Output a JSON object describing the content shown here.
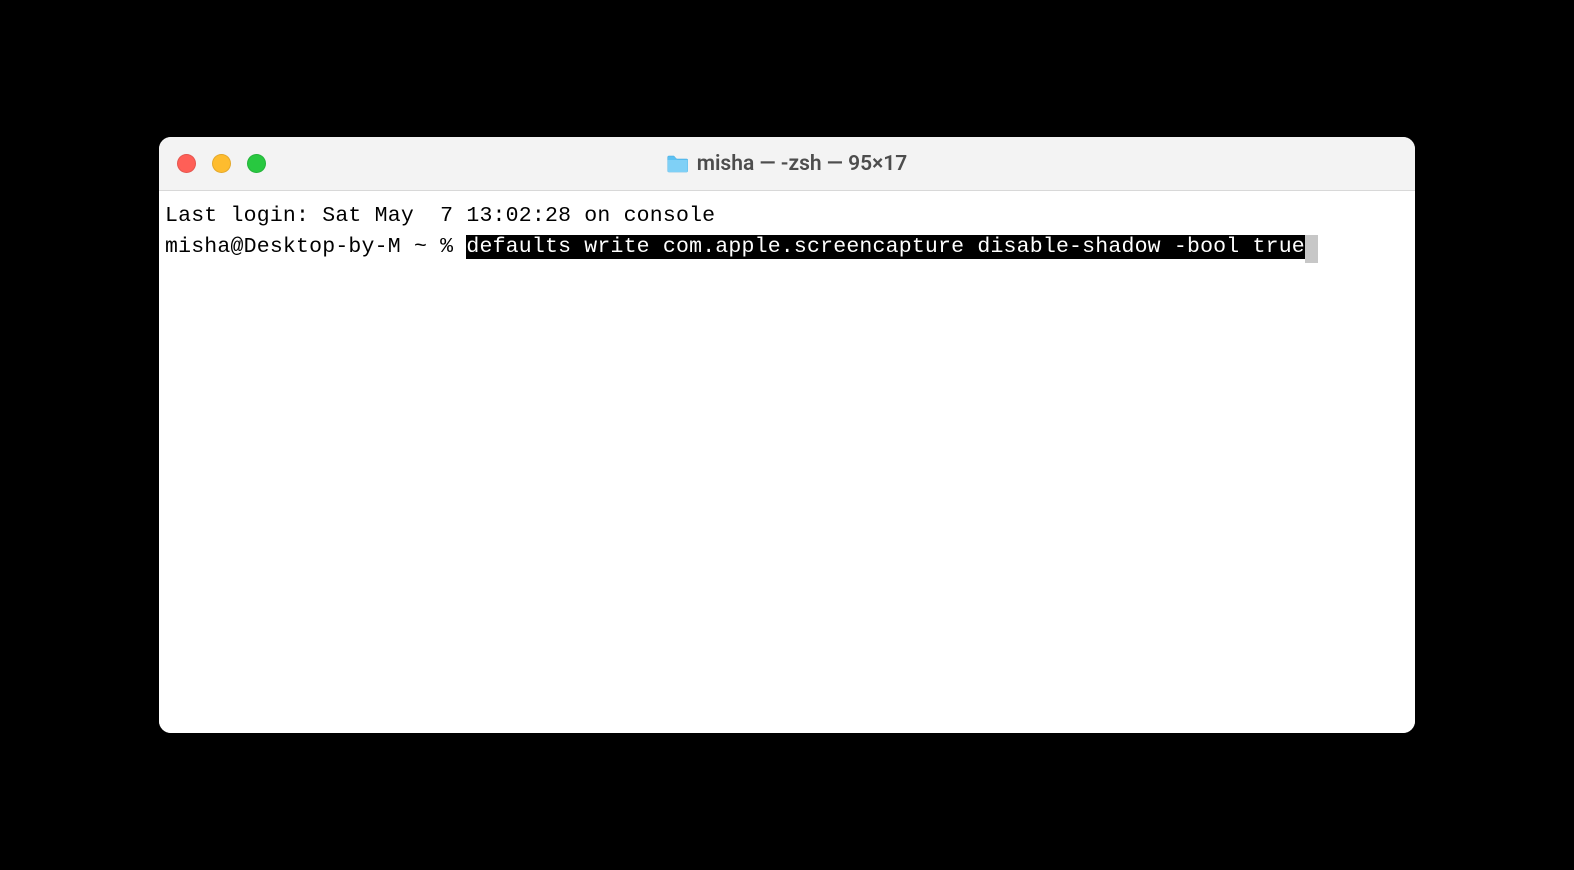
{
  "window": {
    "title": "misha — -zsh — 95×17"
  },
  "terminal": {
    "last_login": "Last login: Sat May  7 13:02:28 on console",
    "prompt": "misha@Desktop-by-M ~ % ",
    "command": "defaults write com.apple.screencapture disable-shadow -bool true"
  }
}
